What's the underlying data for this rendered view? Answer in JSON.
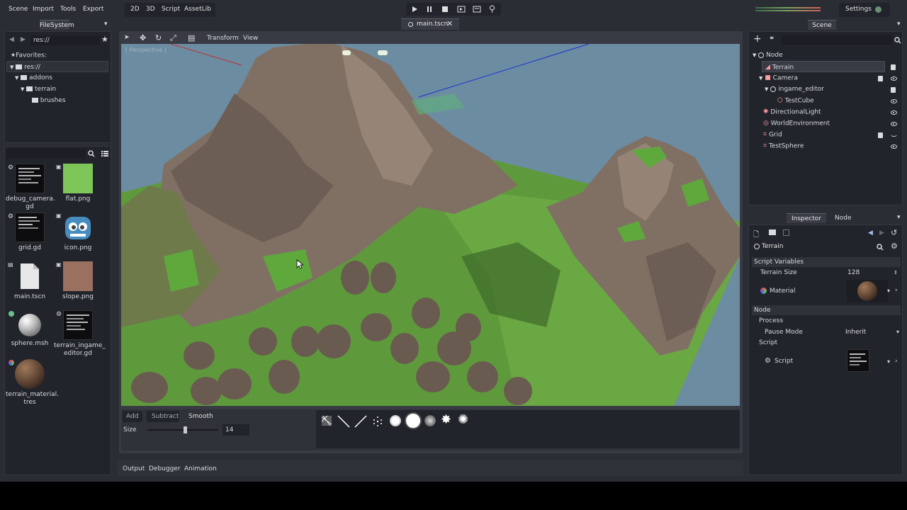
{
  "menu": {
    "scene": "Scene",
    "import": "Import",
    "tools": "Tools",
    "export": "Export"
  },
  "workspaces": {
    "two_d": "2D",
    "three_d": "3D",
    "script": "Script",
    "assetlib": "AssetLib"
  },
  "settings_label": "Settings",
  "filesystem": {
    "tab": "FileSystem",
    "path": "res://",
    "favorites": "Favorites:",
    "tree": [
      {
        "label": "res://"
      },
      {
        "label": "addons"
      },
      {
        "label": "terrain"
      },
      {
        "label": "brushes"
      }
    ],
    "files": [
      {
        "name": "debug_camera.gd",
        "label1": "debug_camera.",
        "label2": "gd"
      },
      {
        "name": "flat.png",
        "label1": "flat.png",
        "label2": ""
      },
      {
        "name": "grid.gd",
        "label1": "grid.gd",
        "label2": ""
      },
      {
        "name": "icon.png",
        "label1": "icon.png",
        "label2": ""
      },
      {
        "name": "main.tscn",
        "label1": "main.tscn",
        "label2": ""
      },
      {
        "name": "slope.png",
        "label1": "slope.png",
        "label2": ""
      },
      {
        "name": "sphere.msh",
        "label1": "sphere.msh",
        "label2": ""
      },
      {
        "name": "terrain_ingame_editor.gd",
        "label1": "terrain_ingame_",
        "label2": "editor.gd"
      },
      {
        "name": "terrain_material.tres",
        "label1": "terrain_material.",
        "label2": "tres"
      }
    ]
  },
  "editor_tab": "main.tscn",
  "viewport": {
    "menu_transform": "Transform",
    "menu_view": "View",
    "perspective_label": "[ Perspective ]"
  },
  "terrain_tools": {
    "add": "Add",
    "subtract": "Subtract",
    "smooth": "Smooth",
    "size_label": "Size",
    "size_value": "14",
    "size_fraction": 0.53
  },
  "bottom_tabs": {
    "output": "Output",
    "debugger": "Debugger",
    "animation": "Animation"
  },
  "scene": {
    "tab": "Scene",
    "nodes": [
      {
        "label": "Node",
        "icon": "node-icon",
        "color": "#d8dbe0"
      },
      {
        "label": "Terrain",
        "icon": "terrain-icon",
        "color": "#fc9c9c"
      },
      {
        "label": "Camera",
        "icon": "camera-icon",
        "color": "#fc9c9c"
      },
      {
        "label": "ingame_editor",
        "icon": "node-icon",
        "color": "#d8dbe0"
      },
      {
        "label": "TestCube",
        "icon": "mesh-instance-icon",
        "color": "#fc9c9c"
      },
      {
        "label": "DirectionalLight",
        "icon": "light-icon",
        "color": "#fc9c9c"
      },
      {
        "label": "WorldEnvironment",
        "icon": "world-environment-icon",
        "color": "#fc9c9c"
      },
      {
        "label": "Grid",
        "icon": "spatial-icon",
        "color": "#fc9c9c"
      },
      {
        "label": "TestSphere",
        "icon": "spatial-icon",
        "color": "#fc9c9c"
      }
    ]
  },
  "inspector": {
    "tab_inspector": "Inspector",
    "tab_node": "Node",
    "object_name": "Terrain",
    "sections": {
      "script_variables": "Script Variables",
      "node": "Node",
      "process": "Process",
      "script": "Script"
    },
    "terrain_size": {
      "label": "Terrain Size",
      "value": "128"
    },
    "material": {
      "label": "Material"
    },
    "pause_mode": {
      "label": "Pause Mode",
      "value": "Inherit"
    },
    "script": {
      "label": "Script"
    }
  },
  "colors": {
    "accent": "#699ce8",
    "bg": "#2b2d35",
    "panel": "#22242b",
    "sky": "#6b8aa0",
    "ground": "#5a9a3a",
    "rock": "#7d6d62"
  }
}
